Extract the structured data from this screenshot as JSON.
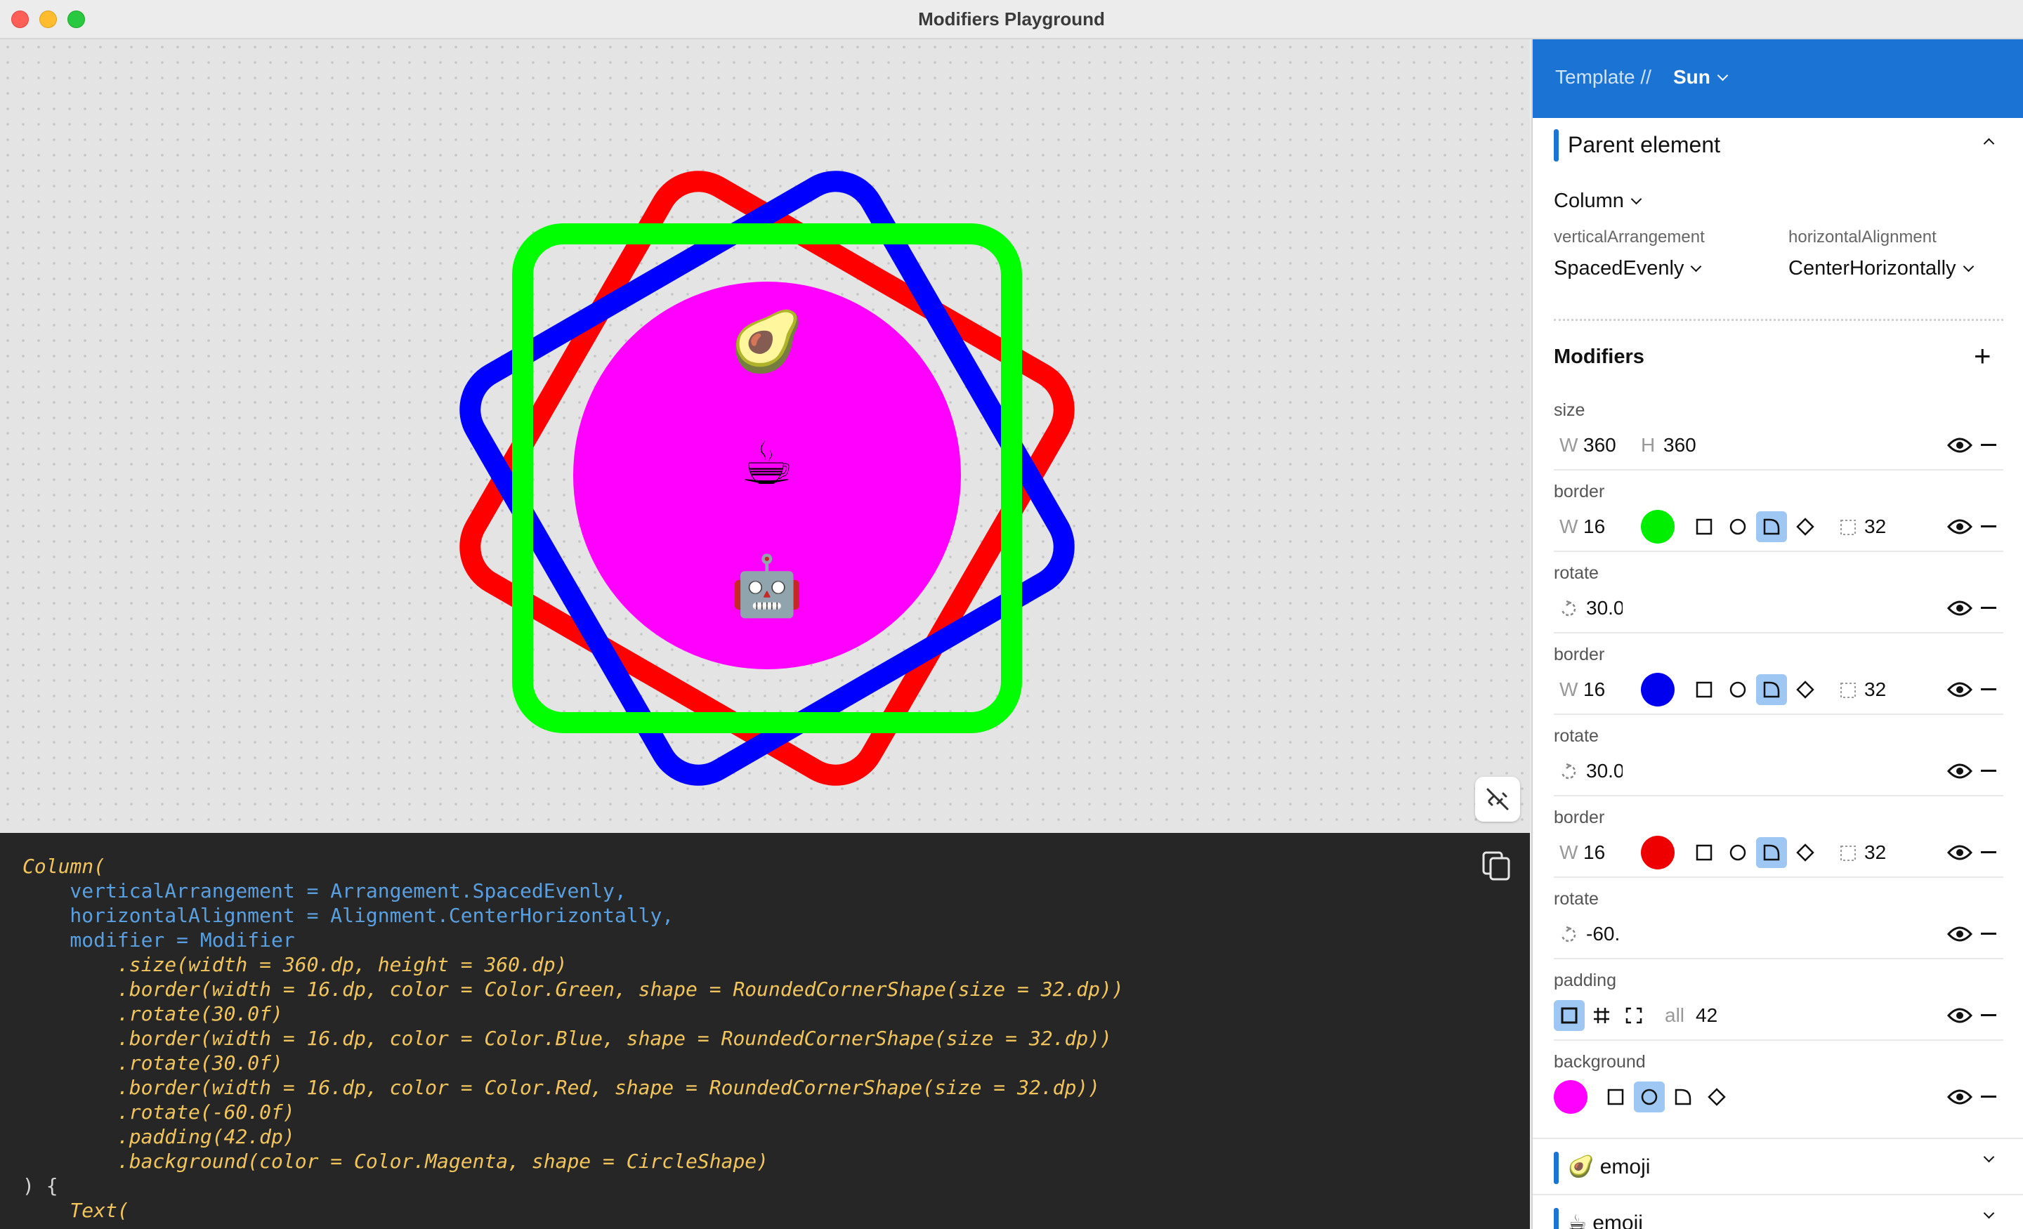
{
  "window": {
    "title": "Modifiers Playground"
  },
  "preview": {
    "emojis": [
      "🥑",
      "☕",
      "🤖"
    ],
    "unlink_icon": "unlink-icon",
    "colors": {
      "green": "#00ff00",
      "blue": "#0000ff",
      "red": "#ff0000",
      "magenta": "#ff00ff"
    }
  },
  "code": {
    "lines": [
      "Column(",
      "    verticalArrangement = Arrangement.SpacedEvenly,",
      "    horizontalAlignment = Alignment.CenterHorizontally,",
      "    modifier = Modifier",
      "        .size(width = 360.dp, height = 360.dp)",
      "        .border(width = 16.dp, color = Color.Green, shape = RoundedCornerShape(size = 32.dp))",
      "        .rotate(30.0f)",
      "        .border(width = 16.dp, color = Color.Blue, shape = RoundedCornerShape(size = 32.dp))",
      "        .rotate(30.0f)",
      "        .border(width = 16.dp, color = Color.Red, shape = RoundedCornerShape(size = 32.dp))",
      "        .rotate(-60.0f)",
      "        .padding(42.dp)",
      "        .background(color = Color.Magenta, shape = CircleShape)",
      ") {",
      "    Text("
    ]
  },
  "panel": {
    "header": {
      "template_label": "Template //",
      "template_value": "Sun"
    },
    "parent": {
      "title": "Parent element",
      "element": "Column",
      "vertical_label": "verticalArrangement",
      "vertical_value": "SpacedEvenly",
      "horizontal_label": "horizontalAlignment",
      "horizontal_value": "CenterHorizontally"
    },
    "modifiers_title": "Modifiers",
    "modifiers": [
      {
        "name": "size",
        "w_label": "W",
        "w": "360",
        "h_label": "H",
        "h": "360"
      },
      {
        "name": "border",
        "w_label": "W",
        "w": "16",
        "color": "#00ee00",
        "radius": "32"
      },
      {
        "name": "rotate",
        "value": "30.0"
      },
      {
        "name": "border",
        "w_label": "W",
        "w": "16",
        "color": "#0000ee",
        "radius": "32"
      },
      {
        "name": "rotate",
        "value": "30.0"
      },
      {
        "name": "border",
        "w_label": "W",
        "w": "16",
        "color": "#ee0000",
        "radius": "32"
      },
      {
        "name": "rotate",
        "value": "-60."
      },
      {
        "name": "padding",
        "all_label": "all",
        "value": "42"
      },
      {
        "name": "background",
        "color": "#ff00ff"
      }
    ],
    "children": [
      {
        "emoji": "🥑",
        "label": "emoji"
      },
      {
        "emoji": "☕",
        "label": "emoji"
      }
    ]
  }
}
